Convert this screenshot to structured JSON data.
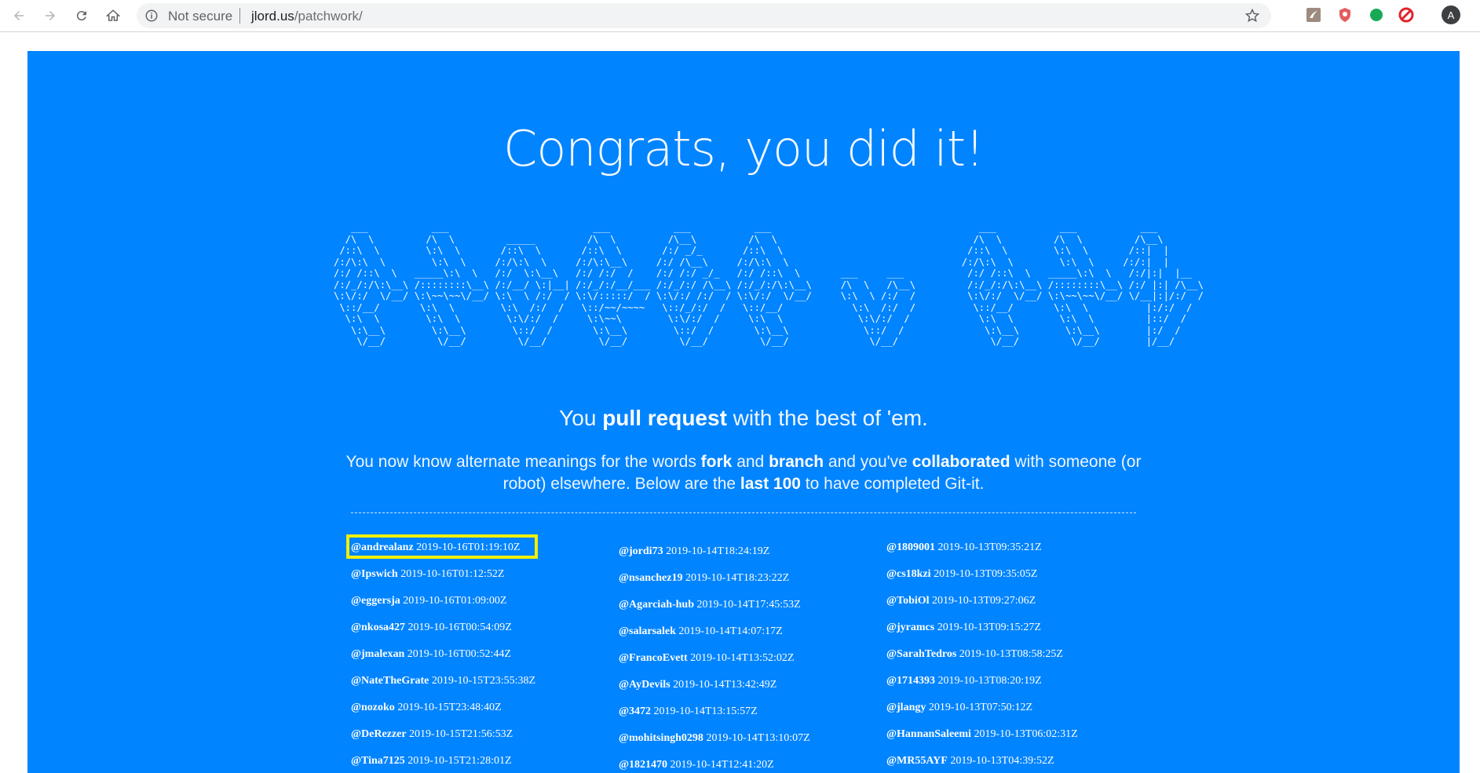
{
  "browser": {
    "security_label": "Not secure",
    "url_host": "jlord.us",
    "url_path": "/patchwork/",
    "profile_initial": "A"
  },
  "page": {
    "headline": "Congrats, you did it!",
    "ascii_art": "   ___           ___                         ___           ___           ___                                    ___           ___           ___     \n  /\\  \\         /\\  \\         _____         /\\  \\         /\\__\\         /\\  \\                                  /\\  \\         /\\  \\         /\\__\\    \n /::\\  \\        \\:\\  \\       /::\\  \\       /::\\  \\       /:/ _/_       /::\\  \\                                /::\\  \\        \\:\\  \\       /::|  |   \n/:/\\:\\  \\        \\:\\  \\     /:/\\:\\  \\     /:/\\:\\__\\     /:/ /\\__\\     /:/\\:\\  \\                              /:/\\:\\  \\        \\:\\  \\     /:/:|  |   \n/:/ /::\\  \\   _____\\:\\  \\   /:/  \\:\\__\\   /:/ /:/  /    /:/ /:/ _/_   /:/ /::\\  \\       ___     ___           /:/ /::\\  \\   _____\\:\\  \\   /:/|:|  |__ \n/:/_/:/\\:\\__\\ /::::::::\\__\\ /:/__/ \\:|__| /:/_/:/__/___ /:/_/:/ /\\__\\ /:/_/:/\\:\\__\\     /\\  \\   /\\__\\         /:/_/:/\\:\\__\\ /::::::::\\__\\ /:/ |:| /\\__\\\n\\:\\/:/  \\/__/ \\:\\~~\\~~\\/__/ \\:\\  \\ /:/  / \\:\\/:::::/  / \\:\\/:/ /:/  / \\:\\/:/  \\/__/     \\:\\  \\ /:/  /         \\:\\/:/  \\/__/ \\:\\~~\\~~\\/__/ \\/__|:|/:/  /\n \\::/__/       \\:\\  \\        \\:\\  /:/  /   \\::/~~/~~~~   \\::/_/:/  /   \\::/__/            \\:\\  /:/  /          \\::/__/       \\:\\  \\          |:/:/  / \n  \\:\\  \\        \\:\\  \\        \\:\\/:/  /     \\:\\~~\\        \\:\\/:/  /     \\:\\  \\             \\:\\/:/  /            \\:\\  \\        \\:\\  \\         |::/  /  \n   \\:\\__\\        \\:\\__\\        \\::/  /       \\:\\__\\        \\::/  /       \\:\\__\\             \\::/  /              \\:\\__\\        \\:\\__\\        |:/  /   \n    \\/__/         \\/__/         \\/__/         \\/__/         \\/__/         \\/__/              \\/__/                \\/__/         \\/__/        |/__/    ",
    "tagline": {
      "pre": "You ",
      "bold": "pull request",
      "post": " with the best of 'em."
    },
    "desc": {
      "t1": "You now know alternate meanings for the words ",
      "b1": "fork",
      "t2": " and ",
      "b2": "branch",
      "t3": " and you've ",
      "b3": "collaborated",
      "t4": " with someone (or robot) elsewhere. Below are the ",
      "b4": "last 100",
      "t5": " to have completed Git-it."
    }
  },
  "completions": {
    "col1": [
      {
        "user": "@andrealanz",
        "time": "2019-10-16T01:19:10Z"
      },
      {
        "user": "@Ipswich",
        "time": "2019-10-16T01:12:52Z"
      },
      {
        "user": "@eggersja",
        "time": "2019-10-16T01:09:00Z"
      },
      {
        "user": "@nkosa427",
        "time": "2019-10-16T00:54:09Z"
      },
      {
        "user": "@jmalexan",
        "time": "2019-10-16T00:52:44Z"
      },
      {
        "user": "@NateTheGrate",
        "time": "2019-10-15T23:55:38Z"
      },
      {
        "user": "@nozoko",
        "time": "2019-10-15T23:48:40Z"
      },
      {
        "user": "@DeRezzer",
        "time": "2019-10-15T21:56:53Z"
      },
      {
        "user": "@Tina7125",
        "time": "2019-10-15T21:28:01Z"
      }
    ],
    "col2": [
      {
        "user": "@jordi73",
        "time": "2019-10-14T18:24:19Z"
      },
      {
        "user": "@nsanchez19",
        "time": "2019-10-14T18:23:22Z"
      },
      {
        "user": "@Agarciah-hub",
        "time": "2019-10-14T17:45:53Z"
      },
      {
        "user": "@salarsalek",
        "time": "2019-10-14T14:07:17Z"
      },
      {
        "user": "@FrancoEvett",
        "time": "2019-10-14T13:52:02Z"
      },
      {
        "user": "@AyDevils",
        "time": "2019-10-14T13:42:49Z"
      },
      {
        "user": "@3472",
        "time": "2019-10-14T13:15:57Z"
      },
      {
        "user": "@mohitsingh0298",
        "time": "2019-10-14T13:10:07Z"
      },
      {
        "user": "@1821470",
        "time": "2019-10-14T12:41:20Z"
      }
    ],
    "col3": [
      {
        "user": "@1809001",
        "time": "2019-10-13T09:35:21Z"
      },
      {
        "user": "@cs18kzi",
        "time": "2019-10-13T09:35:05Z"
      },
      {
        "user": "@TobiOl",
        "time": "2019-10-13T09:27:06Z"
      },
      {
        "user": "@jyramcs",
        "time": "2019-10-13T09:15:27Z"
      },
      {
        "user": "@SarahTedros",
        "time": "2019-10-13T08:58:25Z"
      },
      {
        "user": "@1714393",
        "time": "2019-10-13T08:20:19Z"
      },
      {
        "user": "@jlangy",
        "time": "2019-10-13T07:50:12Z"
      },
      {
        "user": "@HannanSaleemi",
        "time": "2019-10-13T06:02:31Z"
      },
      {
        "user": "@MR55AYF",
        "time": "2019-10-13T04:39:52Z"
      }
    ]
  },
  "colors": {
    "page_bg": "#0084ff",
    "highlight": "#f0f000"
  }
}
